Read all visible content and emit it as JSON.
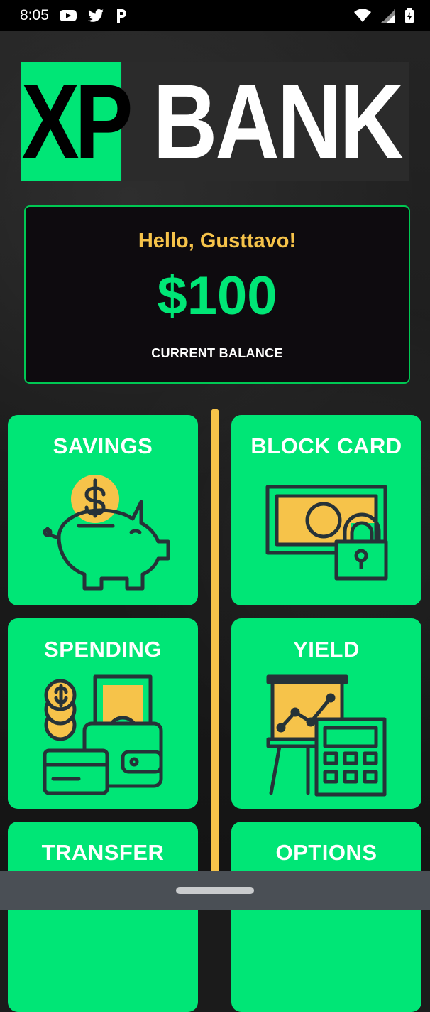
{
  "status_bar": {
    "time": "8:05",
    "icons": [
      "youtube-icon",
      "twitter-icon",
      "p-icon",
      "wifi-icon",
      "signal-icon",
      "battery-icon"
    ]
  },
  "logo": {
    "part1": "XP",
    "part2": "BANK"
  },
  "balance": {
    "greeting": "Hello, Gusttavo!",
    "amount": "$100",
    "label": "CURRENT BALANCE"
  },
  "menu": {
    "savings": "SAVINGS",
    "block_card": "BLOCK CARD",
    "spending": "SPENDING",
    "yield": "YIELD",
    "transfer": "TRANSFER",
    "options": "OPTIONS"
  },
  "colors": {
    "accent_green": "#00e676",
    "accent_yellow": "#f6c34a",
    "dark": "#1b1b1b"
  }
}
